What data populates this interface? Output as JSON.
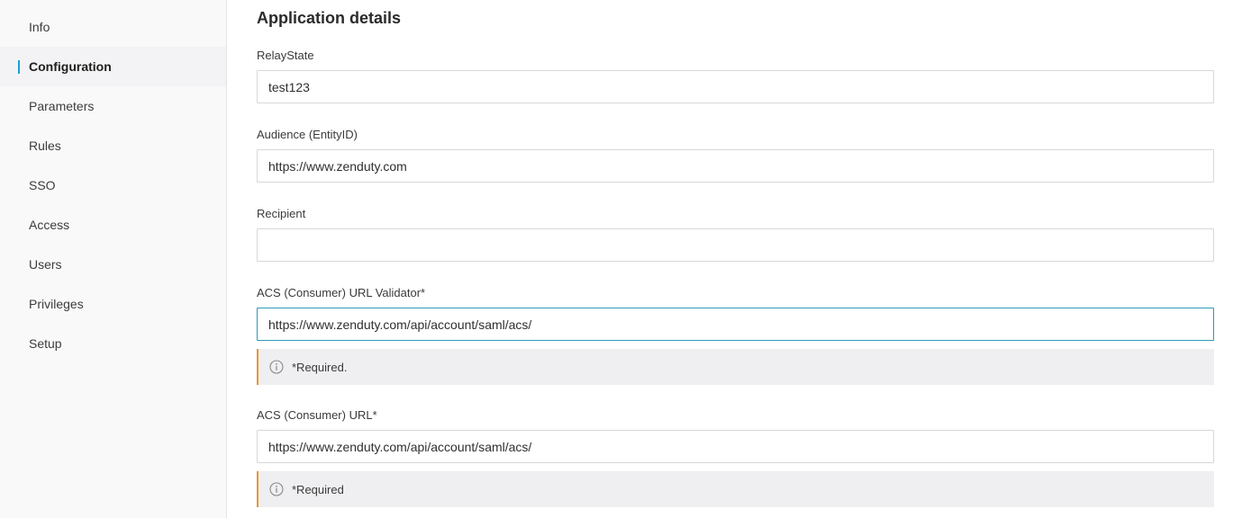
{
  "sidebar": {
    "items": [
      {
        "label": "Info",
        "active": false
      },
      {
        "label": "Configuration",
        "active": true
      },
      {
        "label": "Parameters",
        "active": false
      },
      {
        "label": "Rules",
        "active": false
      },
      {
        "label": "SSO",
        "active": false
      },
      {
        "label": "Access",
        "active": false
      },
      {
        "label": "Users",
        "active": false
      },
      {
        "label": "Privileges",
        "active": false
      },
      {
        "label": "Setup",
        "active": false
      }
    ]
  },
  "main": {
    "title": "Application details",
    "fields": {
      "relay_state": {
        "label": "RelayState",
        "value": "test123"
      },
      "audience": {
        "label": "Audience (EntityID)",
        "value": "https://www.zenduty.com"
      },
      "recipient": {
        "label": "Recipient",
        "value": ""
      },
      "acs_validator": {
        "label": "ACS (Consumer) URL Validator*",
        "value": "https://www.zenduty.com/api/account/saml/acs/",
        "notice": "*Required."
      },
      "acs_url": {
        "label": "ACS (Consumer) URL*",
        "value": "https://www.zenduty.com/api/account/saml/acs/",
        "notice": "*Required"
      }
    }
  },
  "colors": {
    "accent": "#1aa0d6",
    "focus_border": "#2a9bb8",
    "notice_bar": "#e8972f",
    "notice_bg": "#efeff1"
  },
  "icons": {
    "notice": "info-circle-icon"
  }
}
